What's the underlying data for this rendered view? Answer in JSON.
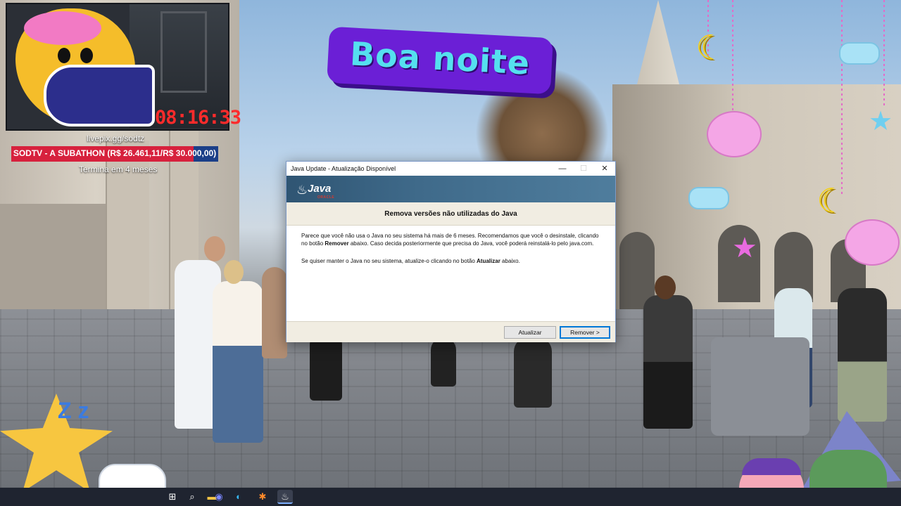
{
  "overlay": {
    "timer": "08:16:33",
    "livepix": "livepix.gg/sodtz",
    "goal_label": "SODTV - A SUBATHON (R$ 26.461,11/R$ 30.000,00)",
    "goal_progress": 0.882,
    "goal_subtext": "Termina em 4 meses",
    "greeting": "Boa noite"
  },
  "dialog": {
    "title": "Java Update - Atualização Disponível",
    "brand": {
      "word": "Java",
      "vendor": "ORACLE"
    },
    "heading": "Remova versões não utilizadas do Java",
    "paragraph1_a": "Parece que você não usa o Java no seu sistema há mais de 6 meses. Recomendamos que você o desinstale, clicando no botão ",
    "paragraph1_bold": "Remover",
    "paragraph1_b": " abaixo. Caso decida posteriormente que precisa do Java, você poderá reinstalá-lo pelo java.com.",
    "paragraph2_a": "Se quiser manter o Java no seu sistema, atualize-o clicando no botão ",
    "paragraph2_bold": "Atualizar",
    "paragraph2_b": " abaixo.",
    "buttons": {
      "update": "Atualizar",
      "remove": "Remover >"
    },
    "window_controls": {
      "minimize": "—",
      "maximize": "☐",
      "close": "✕"
    }
  },
  "taskbar": {
    "icons": [
      "start-icon",
      "search-icon",
      "files-icon",
      "discord-icon",
      "edge-icon",
      "tool-icon",
      "java-icon"
    ],
    "glyphs": [
      "⊞",
      "⌕",
      "▬",
      "◉",
      "◐",
      "✱",
      "♨"
    ],
    "active_index": 6
  },
  "colors": {
    "goal_fill": "#d7213d",
    "goal_bg": "#1b3f88",
    "timer": "#ff2b2b",
    "java_banner": "#3f6a8a",
    "wordart_text": "#55e0ef",
    "wordart_bg": "#6b1fd6"
  }
}
